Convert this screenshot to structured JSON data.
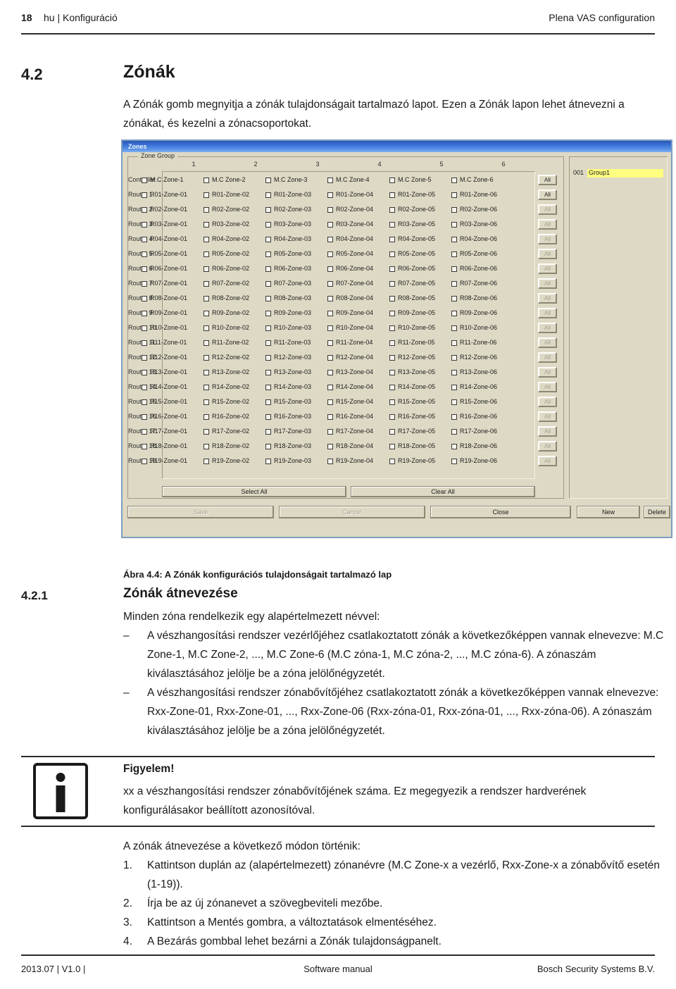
{
  "header": {
    "page_number": "18",
    "left_text": "hu | Konfiguráció",
    "right_text": "Plena VAS configuration"
  },
  "section": {
    "number": "4.2",
    "title": "Zónák",
    "intro": "A Zónák gomb megnyitja a zónák tulajdonságait tartalmazó lapot. Ezen a Zónák lapon lehet átnevezni a zónákat, és kezelni a zónacsoportokat."
  },
  "dialog": {
    "title": "Zones",
    "groupbox_label": "Zone Group",
    "column_headers": [
      "1",
      "2",
      "3",
      "4",
      "5",
      "6"
    ],
    "all_button_label": "All",
    "rows": [
      {
        "label": "Controller",
        "zones": [
          "M.C Zone-1",
          "M.C Zone-2",
          "M.C Zone-3",
          "M.C Zone-4",
          "M.C Zone-5",
          "M.C Zone-6"
        ],
        "all_enabled": true
      },
      {
        "label": "Router 1",
        "zones": [
          "R01-Zone-01",
          "R01-Zone-02",
          "R01-Zone-03",
          "R01-Zone-04",
          "R01-Zone-05",
          "R01-Zone-06"
        ],
        "all_enabled": true
      },
      {
        "label": "Router 2",
        "zones": [
          "R02-Zone-01",
          "R02-Zone-02",
          "R02-Zone-03",
          "R02-Zone-04",
          "R02-Zone-05",
          "R02-Zone-06"
        ],
        "all_enabled": false
      },
      {
        "label": "Router 3",
        "zones": [
          "R03-Zone-01",
          "R03-Zone-02",
          "R03-Zone-03",
          "R03-Zone-04",
          "R03-Zone-05",
          "R03-Zone-06"
        ],
        "all_enabled": false
      },
      {
        "label": "Router 4",
        "zones": [
          "R04-Zone-01",
          "R04-Zone-02",
          "R04-Zone-03",
          "R04-Zone-04",
          "R04-Zone-05",
          "R04-Zone-06"
        ],
        "all_enabled": false
      },
      {
        "label": "Router 5",
        "zones": [
          "R05-Zone-01",
          "R05-Zone-02",
          "R05-Zone-03",
          "R05-Zone-04",
          "R05-Zone-05",
          "R05-Zone-06"
        ],
        "all_enabled": false
      },
      {
        "label": "Router 6",
        "zones": [
          "R06-Zone-01",
          "R06-Zone-02",
          "R06-Zone-03",
          "R06-Zone-04",
          "R06-Zone-05",
          "R06-Zone-06"
        ],
        "all_enabled": false
      },
      {
        "label": "Router 7",
        "zones": [
          "R07-Zone-01",
          "R07-Zone-02",
          "R07-Zone-03",
          "R07-Zone-04",
          "R07-Zone-05",
          "R07-Zone-06"
        ],
        "all_enabled": false
      },
      {
        "label": "Router 8",
        "zones": [
          "R08-Zone-01",
          "R08-Zone-02",
          "R08-Zone-03",
          "R08-Zone-04",
          "R08-Zone-05",
          "R08-Zone-06"
        ],
        "all_enabled": false
      },
      {
        "label": "Router 9",
        "zones": [
          "R09-Zone-01",
          "R09-Zone-02",
          "R09-Zone-03",
          "R09-Zone-04",
          "R09-Zone-05",
          "R09-Zone-06"
        ],
        "all_enabled": false
      },
      {
        "label": "Router 10",
        "zones": [
          "R10-Zone-01",
          "R10-Zone-02",
          "R10-Zone-03",
          "R10-Zone-04",
          "R10-Zone-05",
          "R10-Zone-06"
        ],
        "all_enabled": false
      },
      {
        "label": "Router 11",
        "zones": [
          "R11-Zone-01",
          "R11-Zone-02",
          "R11-Zone-03",
          "R11-Zone-04",
          "R11-Zone-05",
          "R11-Zone-06"
        ],
        "all_enabled": false
      },
      {
        "label": "Router 12",
        "zones": [
          "R12-Zone-01",
          "R12-Zone-02",
          "R12-Zone-03",
          "R12-Zone-04",
          "R12-Zone-05",
          "R12-Zone-06"
        ],
        "all_enabled": false
      },
      {
        "label": "Router 13",
        "zones": [
          "R13-Zone-01",
          "R13-Zone-02",
          "R13-Zone-03",
          "R13-Zone-04",
          "R13-Zone-05",
          "R13-Zone-06"
        ],
        "all_enabled": false
      },
      {
        "label": "Router 14",
        "zones": [
          "R14-Zone-01",
          "R14-Zone-02",
          "R14-Zone-03",
          "R14-Zone-04",
          "R14-Zone-05",
          "R14-Zone-06"
        ],
        "all_enabled": false
      },
      {
        "label": "Router 15",
        "zones": [
          "R15-Zone-01",
          "R15-Zone-02",
          "R15-Zone-03",
          "R15-Zone-04",
          "R15-Zone-05",
          "R15-Zone-06"
        ],
        "all_enabled": false
      },
      {
        "label": "Router 16",
        "zones": [
          "R16-Zone-01",
          "R16-Zone-02",
          "R16-Zone-03",
          "R16-Zone-04",
          "R16-Zone-05",
          "R16-Zone-06"
        ],
        "all_enabled": false
      },
      {
        "label": "Router 17",
        "zones": [
          "R17-Zone-01",
          "R17-Zone-02",
          "R17-Zone-03",
          "R17-Zone-04",
          "R17-Zone-05",
          "R17-Zone-06"
        ],
        "all_enabled": false
      },
      {
        "label": "Router 18",
        "zones": [
          "R18-Zone-01",
          "R18-Zone-02",
          "R18-Zone-03",
          "R18-Zone-04",
          "R18-Zone-05",
          "R18-Zone-06"
        ],
        "all_enabled": false
      },
      {
        "label": "Router 19",
        "zones": [
          "R19-Zone-01",
          "R19-Zone-02",
          "R19-Zone-03",
          "R19-Zone-04",
          "R19-Zone-05",
          "R19-Zone-06"
        ],
        "all_enabled": false
      }
    ],
    "select_all_label": "Select All",
    "clear_all_label": "Clear All",
    "group_list": [
      {
        "index": "001",
        "name": "Group1",
        "highlight_color": "#ffff80"
      }
    ],
    "buttons": {
      "save": "Save",
      "cancel": "Cancel",
      "close": "Close",
      "new": "New",
      "delete": "Delete"
    }
  },
  "figure_caption": "Ábra 4.4: A Zónák konfigurációs tulajdonságait tartalmazó lap",
  "subsection": {
    "number": "4.2.1",
    "title": "Zónák átnevezése",
    "intro": "Minden zóna rendelkezik egy alapértelmezett névvel:",
    "dash_mark": "–",
    "bullets": [
      "A vészhangosítási rendszer vezérlőjéhez csatlakoztatott zónák a következőképpen vannak elnevezve: M.C Zone-1, M.C Zone-2, ..., M.C Zone-6 (M.C zóna-1, M.C zóna-2, ..., M.C zóna-6). A zónaszám kiválasztásához jelölje be a zóna jelölőnégyzetét.",
      "A vészhangosítási rendszer zónabővítőjéhez csatlakoztatott zónák a következőképpen vannak elnevezve: Rxx-Zone-01, Rxx-Zone-01, ..., Rxx-Zone-06 (Rxx-zóna-01, Rxx-zóna-01, ..., Rxx-zóna-06). A zónaszám kiválasztásához jelölje be a zóna jelölőnégyzetét."
    ]
  },
  "notice": {
    "title": "Figyelem!",
    "text": "xx a vészhangosítási rendszer zónabővítőjének száma. Ez megegyezik a rendszer hardverének konfigurálásakor beállított azonosítóval."
  },
  "procedure": {
    "intro": "A zónák átnevezése a következő módon történik:",
    "steps": [
      {
        "mark": "1.",
        "text": "Kattintson duplán az (alapértelmezett) zónanévre (M.C Zone-x a vezérlő, Rxx-Zone-x a zónabővítő esetén (1-19))."
      },
      {
        "mark": "2.",
        "text": "Írja be az új zónanevet a szövegbeviteli mezőbe."
      },
      {
        "mark": "3.",
        "text": "Kattintson a Mentés gombra, a változtatások elmentéséhez."
      },
      {
        "mark": "4.",
        "text": "A Bezárás gombbal lehet bezárni a Zónák tulajdonságpanelt."
      }
    ]
  },
  "footer": {
    "left": "2013.07 | V1.0 |",
    "center": "Software manual",
    "right": "Bosch Security Systems B.V."
  }
}
